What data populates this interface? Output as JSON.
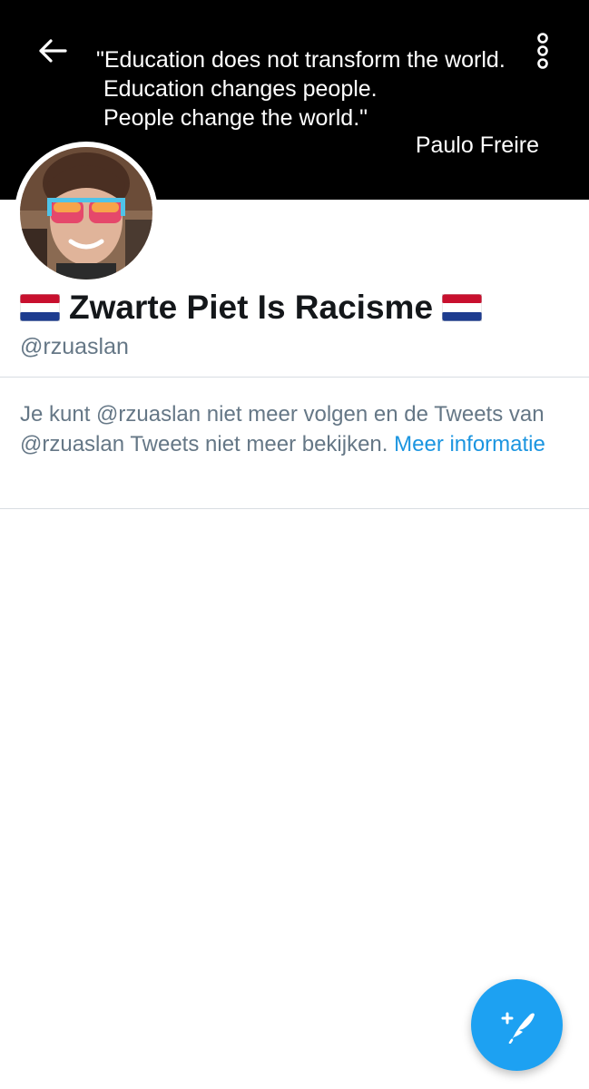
{
  "header": {
    "quote_lines": [
      "\"Education does not transform the world.",
      "Education changes people.",
      "People change the world.\""
    ],
    "quote_author": "Paulo Freire"
  },
  "profile": {
    "display_name": "Zwarte Piet Is Racisme",
    "handle": "@rzuaslan",
    "flag_icon": "netherlands-flag",
    "notice_text": "Je kunt @rzuaslan niet meer volgen en de Tweets van @rzuaslan Tweets niet meer bekijken.",
    "notice_link": "Meer informatie"
  },
  "colors": {
    "banner": "#000000",
    "link": "#1b95e0",
    "fab": "#1da1f2",
    "secondary_text": "#657786"
  },
  "icons": {
    "back": "back-arrow-icon",
    "more": "more-options-icon",
    "compose": "compose-tweet-icon"
  }
}
